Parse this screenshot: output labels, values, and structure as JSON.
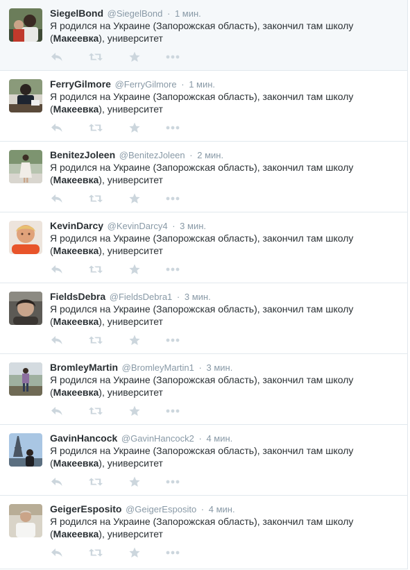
{
  "tweets": [
    {
      "fullname": "SiegelBond",
      "username": "@SiegelBond",
      "time": "1 мин.",
      "text_before": "Я родился на Украине (Запорожская область), закончил там школу (",
      "text_bold": "Макеевка",
      "text_after": "), университет",
      "avatar_icon": "person-photo"
    },
    {
      "fullname": "FerryGilmore",
      "username": "@FerryGilmore",
      "time": "1 мин.",
      "text_before": "Я родился на Украине (Запорожская область), закончил там школу (",
      "text_bold": "Макеевка",
      "text_after": "), университет",
      "avatar_icon": "person-photo"
    },
    {
      "fullname": "BenitezJoleen",
      "username": "@BenitezJoleen",
      "time": "2 мин.",
      "text_before": "Я родился на Украине (Запорожская область), закончил там школу (",
      "text_bold": "Макеевка",
      "text_after": "), университет",
      "avatar_icon": "person-photo"
    },
    {
      "fullname": "KevinDarcy",
      "username": "@KevinDarcy4",
      "time": "3 мин.",
      "text_before": "Я родился на Украине (Запорожская область), закончил там школу (",
      "text_bold": "Макеевка",
      "text_after": "), университет",
      "avatar_icon": "person-photo"
    },
    {
      "fullname": "FieldsDebra",
      "username": "@FieldsDebra1",
      "time": "3 мин.",
      "text_before": "Я родился на Украине (Запорожская область), закончил там школу (",
      "text_bold": "Макеевка",
      "text_after": "), университет",
      "avatar_icon": "person-photo"
    },
    {
      "fullname": "BromleyMartin",
      "username": "@BromleyMartin1",
      "time": "3 мин.",
      "text_before": "Я родился на Украине (Запорожская область), закончил там школу (",
      "text_bold": "Макеевка",
      "text_after": "), университет",
      "avatar_icon": "person-photo"
    },
    {
      "fullname": "GavinHancock",
      "username": "@GavinHancock2",
      "time": "4 мин.",
      "text_before": "Я родился на Украине (Запорожская область), закончил там школу (",
      "text_bold": "Макеевка",
      "text_after": "), университет",
      "avatar_icon": "person-photo"
    },
    {
      "fullname": "GeigerEsposito",
      "username": "@GeigerEsposito",
      "time": "4 мин.",
      "text_before": "Я родился на Украине (Запорожская область), закончил там школу (",
      "text_bold": "Макеевка",
      "text_after": "), университет",
      "avatar_icon": "person-photo"
    }
  ],
  "separator": "·",
  "actions": [
    "reply-icon",
    "retweet-icon",
    "favorite-icon",
    "more-icon"
  ],
  "colors": {
    "icon": "#ccd6dd",
    "meta": "#8899a6",
    "text": "#292f33",
    "border": "#e1e8ed",
    "hover_bg": "#f5f8fa"
  }
}
